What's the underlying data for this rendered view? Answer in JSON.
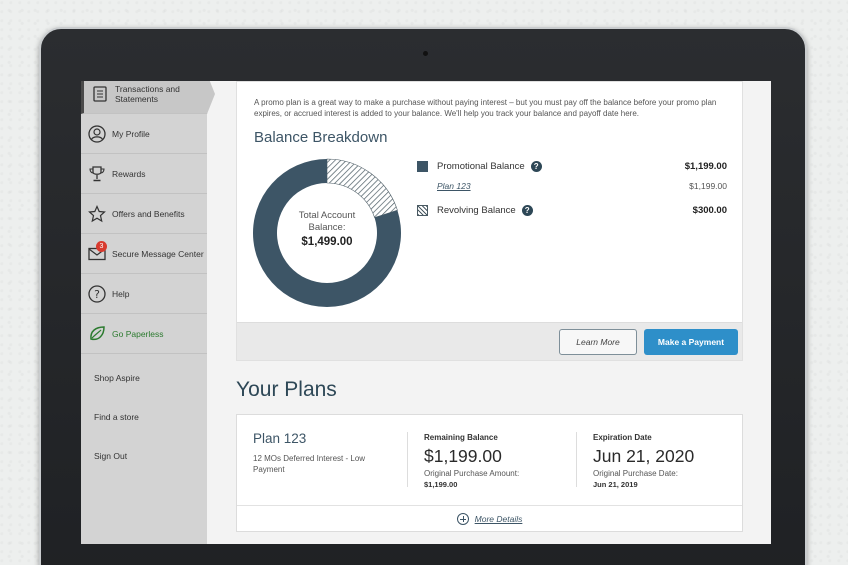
{
  "sidebar": {
    "items": [
      {
        "label": "Transactions and Statements",
        "icon": "document-icon"
      },
      {
        "label": "My Profile",
        "icon": "user-icon"
      },
      {
        "label": "Rewards",
        "icon": "trophy-icon"
      },
      {
        "label": "Offers and Benefits",
        "icon": "star-icon"
      },
      {
        "label": "Secure Message Center",
        "icon": "envelope-icon",
        "badge": "3"
      },
      {
        "label": "Help",
        "icon": "question-icon"
      },
      {
        "label": "Go Paperless",
        "icon": "leaf-icon"
      },
      {
        "label": "Shop Aspire"
      },
      {
        "label": "Find a store"
      },
      {
        "label": "Sign Out"
      }
    ]
  },
  "balance": {
    "intro": "A promo plan is a great way to make a purchase without paying interest – but you must pay off the balance before your promo plan expires, or accrued interest is added to your balance. We'll help you track your balance and payoff date here.",
    "title": "Balance Breakdown",
    "donut_label": "Total Account Balance:",
    "total": "$1,499.00",
    "promotional_label": "Promotional Balance",
    "promotional_amount": "$1,199.00",
    "plan_link": "Plan 123",
    "plan_amount": "$1,199.00",
    "revolving_label": "Revolving Balance",
    "revolving_amount": "$300.00",
    "help_glyph": "?",
    "learn_more": "Learn More",
    "make_payment": "Make a Payment"
  },
  "plans": {
    "heading": "Your Plans",
    "plan_name": "Plan 123",
    "plan_desc": "12 MOs Deferred Interest - Low Payment",
    "remaining_header": "Remaining Balance",
    "remaining_value": "$1,199.00",
    "original_label": "Original Purchase Amount:",
    "original_value": "$1,199.00",
    "expiration_header": "Expiration Date",
    "expiration_value": "Jun 21, 2020",
    "original_date_label": "Original Purchase Date:",
    "original_date_value": "Jun 21, 2019",
    "more_details": "More Details"
  },
  "colors": {
    "dark_slate": "#3d5566",
    "pay_button": "#2e8fc9",
    "paperless_green": "#2b7a2e",
    "badge_red": "#d83a2e"
  },
  "chart_data": {
    "type": "pie",
    "categories": [
      "Promotional Balance",
      "Revolving Balance"
    ],
    "values": [
      1199,
      300
    ]
  }
}
